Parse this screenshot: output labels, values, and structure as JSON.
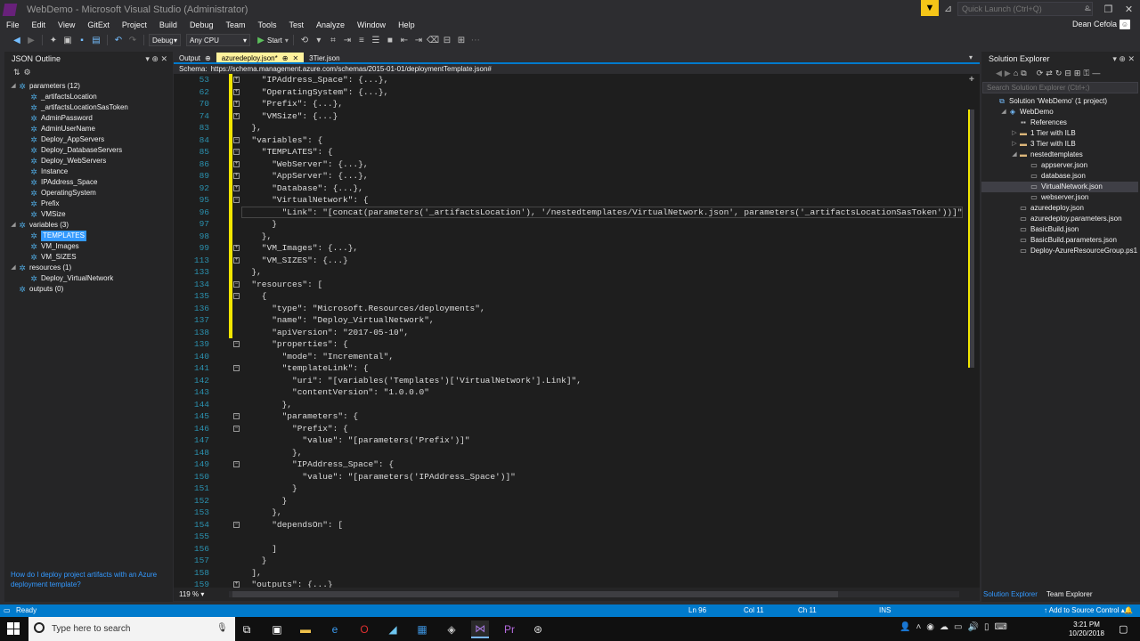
{
  "window": {
    "title": "WebDemo - Microsoft Visual Studio (Administrator)",
    "quick_launch_placeholder": "Quick Launch (Ctrl+Q)",
    "user": "Dean Cefola"
  },
  "menu": [
    "File",
    "Edit",
    "View",
    "GitExt",
    "Project",
    "Build",
    "Debug",
    "Team",
    "Tools",
    "Test",
    "Analyze",
    "Window",
    "Help"
  ],
  "toolbar": {
    "config": "Debug",
    "platform": "Any CPU",
    "start_label": "Start"
  },
  "outline": {
    "title": "JSON Outline",
    "items": [
      {
        "label": "parameters (12)",
        "level": 0,
        "expanded": true
      },
      {
        "label": "_artifactsLocation",
        "level": 1
      },
      {
        "label": "_artifactsLocationSasToken",
        "level": 1
      },
      {
        "label": "AdminPassword",
        "level": 1
      },
      {
        "label": "AdminUserName",
        "level": 1
      },
      {
        "label": "Deploy_AppServers",
        "level": 1
      },
      {
        "label": "Deploy_DatabaseServers",
        "level": 1
      },
      {
        "label": "Deploy_WebServers",
        "level": 1
      },
      {
        "label": "Instance",
        "level": 1
      },
      {
        "label": "IPAddress_Space",
        "level": 1
      },
      {
        "label": "OperatingSystem",
        "level": 1
      },
      {
        "label": "Prefix",
        "level": 1
      },
      {
        "label": "VMSize",
        "level": 1
      },
      {
        "label": "variables (3)",
        "level": 0,
        "expanded": true
      },
      {
        "label": "TEMPLATES",
        "level": 1,
        "selected": true
      },
      {
        "label": "VM_Images",
        "level": 1
      },
      {
        "label": "VM_SIZES",
        "level": 1
      },
      {
        "label": "resources (1)",
        "level": 0,
        "expanded": true
      },
      {
        "label": "Deploy_VirtualNetwork",
        "level": 1
      },
      {
        "label": "outputs (0)",
        "level": 0
      }
    ],
    "help_link": "How do I deploy project artifacts with an Azure deployment template?"
  },
  "tabs": [
    {
      "label": "Output",
      "pin": "⊕",
      "active": false
    },
    {
      "label": "azuredeploy.json*",
      "pin": "⊕",
      "active": true
    },
    {
      "label": "3Tier.json",
      "active": false
    }
  ],
  "schema": {
    "label": "Schema:",
    "value": "https://schema.management.azure.com/schemas/2015-01-01/deploymentTemplate.json#"
  },
  "code": [
    {
      "n": "53",
      "t": "    \"IPAddress_Space\": {...},",
      "fold": true
    },
    {
      "n": "62",
      "t": "    \"OperatingSystem\": {...},",
      "fold": true
    },
    {
      "n": "70",
      "t": "    \"Prefix\": {...},",
      "fold": true
    },
    {
      "n": "74",
      "t": "    \"VMSize\": {...}",
      "fold": true
    },
    {
      "n": "83",
      "t": "  },"
    },
    {
      "n": "84",
      "t": "  \"variables\": {",
      "fold": true
    },
    {
      "n": "85",
      "t": "    \"TEMPLATES\": {",
      "fold": true
    },
    {
      "n": "86",
      "t": "      \"WebServer\": {...},",
      "fold": true
    },
    {
      "n": "89",
      "t": "      \"AppServer\": {...},",
      "fold": true
    },
    {
      "n": "92",
      "t": "      \"Database\": {...},",
      "fold": true
    },
    {
      "n": "95",
      "t": "      \"VirtualNetwork\": {",
      "fold": true
    },
    {
      "n": "96",
      "t": "        \"Link\": \"[concat(parameters('_artifactsLocation'), '/nestedtemplates/VirtualNetwork.json', parameters('_artifactsLocationSasToken'))]\""
    },
    {
      "n": "97",
      "t": "      }"
    },
    {
      "n": "98",
      "t": "    },"
    },
    {
      "n": "99",
      "t": "    \"VM_Images\": {...},",
      "fold": true
    },
    {
      "n": "113",
      "t": "    \"VM_SIZES\": {...}",
      "fold": true
    },
    {
      "n": "133",
      "t": "  },"
    },
    {
      "n": "134",
      "t": "  \"resources\": [",
      "fold": true
    },
    {
      "n": "135",
      "t": "    {",
      "fold": true
    },
    {
      "n": "136",
      "t": "      \"type\": \"Microsoft.Resources/deployments\","
    },
    {
      "n": "137",
      "t": "      \"name\": \"Deploy_VirtualNetwork\","
    },
    {
      "n": "138",
      "t": "      \"apiVersion\": \"2017-05-10\","
    },
    {
      "n": "139",
      "t": "      \"properties\": {",
      "fold": true
    },
    {
      "n": "140",
      "t": "        \"mode\": \"Incremental\","
    },
    {
      "n": "141",
      "t": "        \"templateLink\": {",
      "fold": true
    },
    {
      "n": "142",
      "t": "          \"uri\": \"[variables('Templates')['VirtualNetwork'].Link]\","
    },
    {
      "n": "143",
      "t": "          \"contentVersion\": \"1.0.0.0\""
    },
    {
      "n": "144",
      "t": "        },"
    },
    {
      "n": "145",
      "t": "        \"parameters\": {",
      "fold": true
    },
    {
      "n": "146",
      "t": "          \"Prefix\": {",
      "fold": true
    },
    {
      "n": "147",
      "t": "            \"value\": \"[parameters('Prefix')]\""
    },
    {
      "n": "148",
      "t": "          },"
    },
    {
      "n": "149",
      "t": "          \"IPAddress_Space\": {",
      "fold": true
    },
    {
      "n": "150",
      "t": "            \"value\": \"[parameters('IPAddress_Space')]\""
    },
    {
      "n": "151",
      "t": "          }"
    },
    {
      "n": "152",
      "t": "        }"
    },
    {
      "n": "153",
      "t": "      },"
    },
    {
      "n": "154",
      "t": "      \"dependsOn\": [",
      "fold": true
    },
    {
      "n": "155",
      "t": ""
    },
    {
      "n": "156",
      "t": "      ]"
    },
    {
      "n": "157",
      "t": "    }"
    },
    {
      "n": "158",
      "t": "  ],"
    },
    {
      "n": "159",
      "t": "  \"outputs\": {...}",
      "fold": true
    }
  ],
  "editor": {
    "zoom": "119 %"
  },
  "solution_explorer": {
    "title": "Solution Explorer",
    "search_placeholder": "Search Solution Explorer (Ctrl+;)",
    "items": [
      {
        "label": "Solution 'WebDemo' (1 project)",
        "level": 0,
        "icon": "solution"
      },
      {
        "label": "WebDemo",
        "level": 1,
        "icon": "project",
        "expanded": true
      },
      {
        "label": "References",
        "level": 2,
        "icon": "refs"
      },
      {
        "label": "1 Tier with ILB",
        "level": 2,
        "icon": "folder",
        "collapsed": true
      },
      {
        "label": "3 Tier with ILB",
        "level": 2,
        "icon": "folder",
        "collapsed": true
      },
      {
        "label": "nestedtemplates",
        "level": 2,
        "icon": "folder",
        "expanded": true
      },
      {
        "label": "appserver.json",
        "level": 3,
        "icon": "file"
      },
      {
        "label": "database.json",
        "level": 3,
        "icon": "file"
      },
      {
        "label": "VirtualNetwork.json",
        "level": 3,
        "icon": "file",
        "selected": true
      },
      {
        "label": "webserver.json",
        "level": 3,
        "icon": "file"
      },
      {
        "label": "azuredeploy.json",
        "level": 2,
        "icon": "file"
      },
      {
        "label": "azuredeploy.parameters.json",
        "level": 2,
        "icon": "file"
      },
      {
        "label": "BasicBuild.json",
        "level": 2,
        "icon": "file"
      },
      {
        "label": "BasicBuild.parameters.json",
        "level": 2,
        "icon": "file"
      },
      {
        "label": "Deploy-AzureResourceGroup.ps1",
        "level": 2,
        "icon": "file"
      }
    ],
    "tabs": [
      "Solution Explorer",
      "Team Explorer"
    ]
  },
  "status": {
    "ready": "Ready",
    "ln": "Ln 96",
    "col": "Col 11",
    "ch": "Ch 11",
    "mode": "INS",
    "source_control": "Add to Source Control"
  },
  "taskbar": {
    "search_placeholder": "Type here to search",
    "time": "3:21 PM",
    "date": "10/20/2018"
  },
  "colors": {
    "accent": "#007acc",
    "editor_bg": "#1e1e1e",
    "active_tab": "#fff29d",
    "notification": "#f5c518",
    "line_number": "#2b91af",
    "string": "#d69d85"
  }
}
